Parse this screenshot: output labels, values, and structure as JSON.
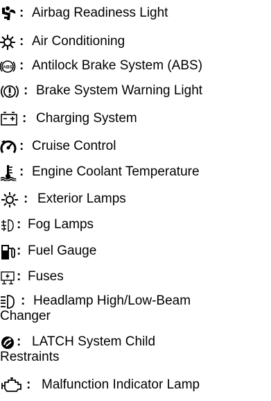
{
  "separator": ":",
  "items": [
    {
      "icon": "airbag-readiness-icon",
      "label": "Airbag Readiness Light"
    },
    {
      "icon": "air-conditioning-icon",
      "label": "Air Conditioning"
    },
    {
      "icon": "abs-icon",
      "icon_text": "ABS",
      "label": "Antilock Brake System (ABS)"
    },
    {
      "icon": "brake-warning-icon",
      "label": "Brake System Warning Light"
    },
    {
      "icon": "battery-charging-icon",
      "label": "Charging System"
    },
    {
      "icon": "cruise-control-icon",
      "label": "Cruise Control"
    },
    {
      "icon": "coolant-temperature-icon",
      "label": "Engine Coolant Temperature"
    },
    {
      "icon": "exterior-lamps-icon",
      "label": "Exterior Lamps"
    },
    {
      "icon": "fog-lamps-icon",
      "label": "Fog Lamps"
    },
    {
      "icon": "fuel-gauge-icon",
      "label": "Fuel Gauge"
    },
    {
      "icon": "fuses-icon",
      "label": "Fuses"
    },
    {
      "icon": "high-beam-icon",
      "label": "Headlamp High/Low-Beam",
      "label_cont": "Changer"
    },
    {
      "icon": "latch-child-seat-icon",
      "label": "LATCH System Child",
      "label_cont": "Restraints"
    },
    {
      "icon": "engine-malfunction-icon",
      "label": "Malfunction Indicator Lamp"
    }
  ]
}
